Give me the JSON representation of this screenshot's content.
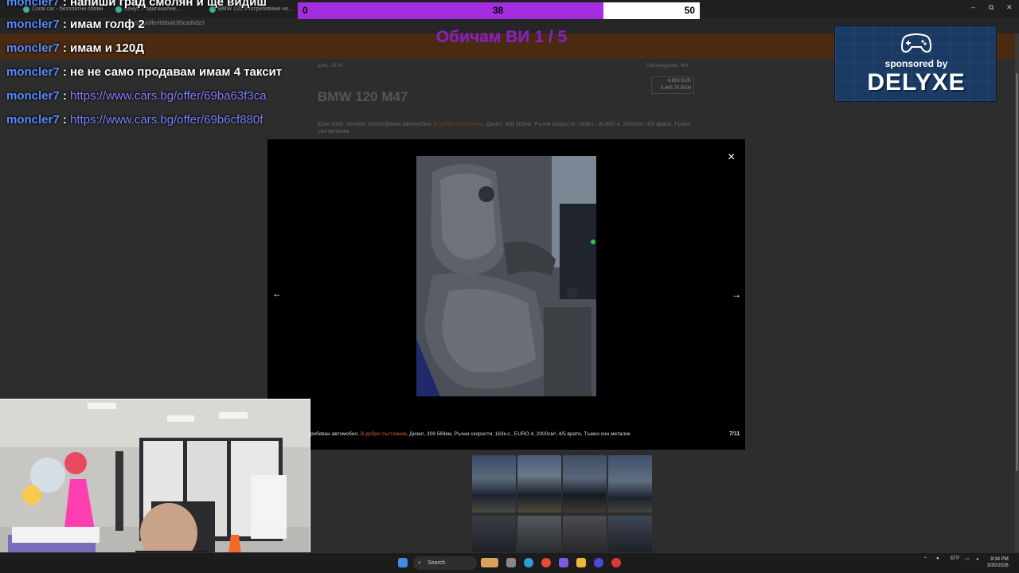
{
  "browser": {
    "tabs": [
      "Coral car - безплатни обяви",
      "Бонус 7 оригинални...",
      "BMW 120 Употребявани на..."
    ],
    "url": "cars.bg/offer/69ba63f3ca06d23",
    "window_controls": [
      "–",
      "⧉",
      "✕"
    ]
  },
  "listing": {
    "date_label": "днес, 09:40",
    "views_label": "Разглеждания: 463",
    "price_eur": "4,650 EUR",
    "price_bgn": "9,485.76 BGN",
    "title": "BMW 120 M47",
    "desc_before": "Юни 2005, Хечбек, Употребяван автомобил, ",
    "desc_highlight": "В добро състояние",
    "desc_after": ", Дизел, 308 569км, Ръчни скорости, 163к.с., EURO 4, 2000см³, 4/5 врати, Тъмно син металик"
  },
  "chat": [
    {
      "user": "moncler7",
      "text": "напиши град смолян и ще видиш",
      "link": false
    },
    {
      "user": "moncler7",
      "text": "имам голф 2",
      "link": false
    },
    {
      "user": "moncler7",
      "text": "имам и 120Д",
      "link": false
    },
    {
      "user": "moncler7",
      "text": "не не само продавам имам 4 таксит",
      "link": false
    },
    {
      "user": "moncler7",
      "text": "https://www.cars.bg/offer/69ba63f3ca",
      "link": true
    },
    {
      "user": "moncler7",
      "text": "https://www.cars.bg/offer/69b6cf880f",
      "link": true
    }
  ],
  "vote": {
    "left": "0",
    "mid": "38",
    "right": "50",
    "fill_fraction": 0.76,
    "title": "Обичам ВИ 1 / 5",
    "fill_color": "#a52de0"
  },
  "sponsor": {
    "by": "sponsored by",
    "brand": "DELYXE",
    "icon": "gamepad-icon"
  },
  "modal": {
    "close": "×",
    "prev": "←",
    "next": "→",
    "caption_before": "ребяван автомобил, ",
    "caption_highlight": "В добро състояние",
    "caption_after": ", Дизел, 308 569км, Ръчни скорости, 163к.с., EURO 4, 2000см³, 4/5 врати, Тъмно син металик",
    "counter": "7/11"
  },
  "taskbar": {
    "search": "Search",
    "lang": "БГР",
    "time": "9:34 PM",
    "date": "3/30/2026"
  }
}
